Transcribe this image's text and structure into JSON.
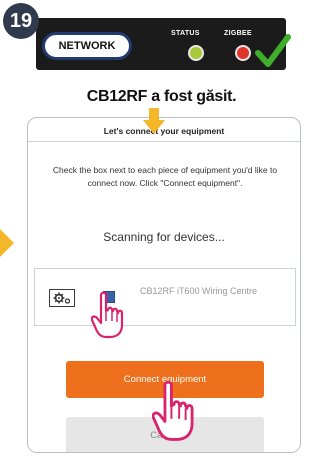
{
  "step": {
    "number": "19"
  },
  "device_panel": {
    "network_label": "NETWORK",
    "status_label": "STATUS",
    "zigbee_label": "ZIGBEE",
    "status_led_color": "#a9c93b",
    "zigbee_led_color": "#e0352b"
  },
  "caption": "CB12RF a fost găsit.",
  "dialog": {
    "title": "Let's connect your equipment",
    "instructions": "Check the box next to each piece of equipment you'd like to connect now. Click \"Connect equipment\".",
    "scanning": "Scanning for devices...",
    "device": {
      "name": "CB12RF iT600 Wiring Centre",
      "checked": true
    },
    "connect_label": "Connect equipment",
    "cancel_label": "Cancel"
  },
  "colors": {
    "accent_orange": "#ee6f1c",
    "arrow_yellow": "#f5b72a",
    "brand_navy": "#233a6e",
    "check_green": "#3fae2a"
  },
  "icons": [
    "check-mark-icon",
    "arrow-down-icon",
    "arrow-right-icon",
    "gears-icon",
    "pointer-hand-icon"
  ]
}
